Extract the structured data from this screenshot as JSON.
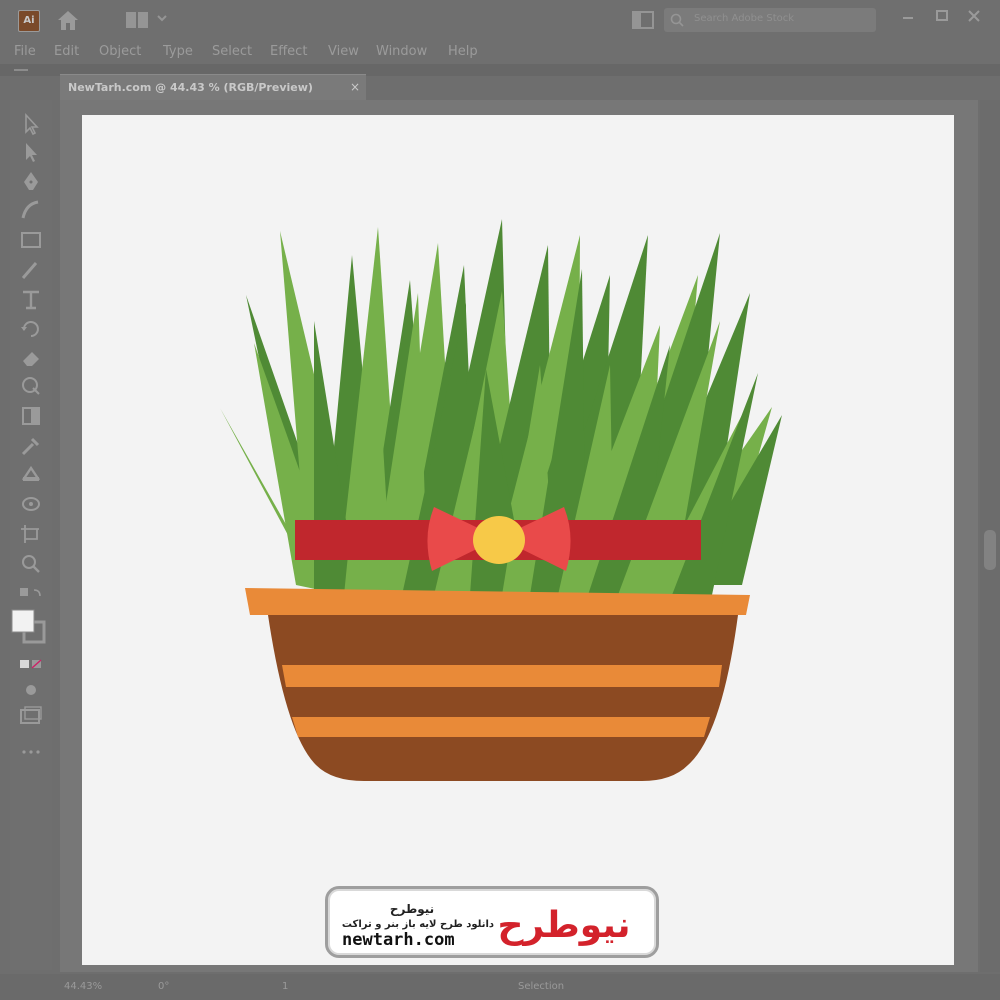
{
  "document": {
    "tab_label": "NewTarh.com @ 44.43 % (RGB/Preview)",
    "close_glyph": "×"
  },
  "app": {
    "logo_text": "Ai"
  },
  "search": {
    "placeholder": "Search Adobe Stock"
  },
  "menu": {
    "items": [
      "File",
      "Edit",
      "Object",
      "Type",
      "Select",
      "Effect",
      "View",
      "Window",
      "Help"
    ]
  },
  "statusbar": {
    "zoom": "44.43%",
    "rotation": "0°",
    "artboard": "1",
    "tool": "Selection"
  },
  "watermark": {
    "logo_text": "نیوطرح",
    "title": "نیوطرح",
    "subtitle": "دانلود طرح لایه باز بنر و تراکت",
    "url": "newtarh.com"
  },
  "icons": {
    "home": "home-icon",
    "search": "search-icon",
    "workspace": "workspace-switcher-icon",
    "arrange": "arrange-documents-icon",
    "minimize": "minimize-icon",
    "maximize": "maximize-icon",
    "close": "close-icon",
    "tools": [
      "selection-tool-icon",
      "direct-selection-tool-icon",
      "pen-tool-icon",
      "curvature-tool-icon",
      "rectangle-tool-icon",
      "paintbrush-tool-icon",
      "type-tool-icon",
      "rotate-tool-icon",
      "eraser-tool-icon",
      "shape-builder-tool-icon",
      "gradient-tool-icon",
      "eyedropper-tool-icon",
      "blend-tool-icon",
      "symbol-sprayer-tool-icon",
      "artboard-tool-icon",
      "zoom-tool-icon"
    ]
  },
  "colors": {
    "grass_dark": "#4f8a35",
    "grass_light": "#76b04a",
    "ribbon": "#c0272d",
    "bow": "#e94a4a",
    "knot": "#f7c948",
    "pot_rim": "#e98a38",
    "pot_dark": "#8c4a22",
    "pot_stripe": "#e98a38"
  }
}
